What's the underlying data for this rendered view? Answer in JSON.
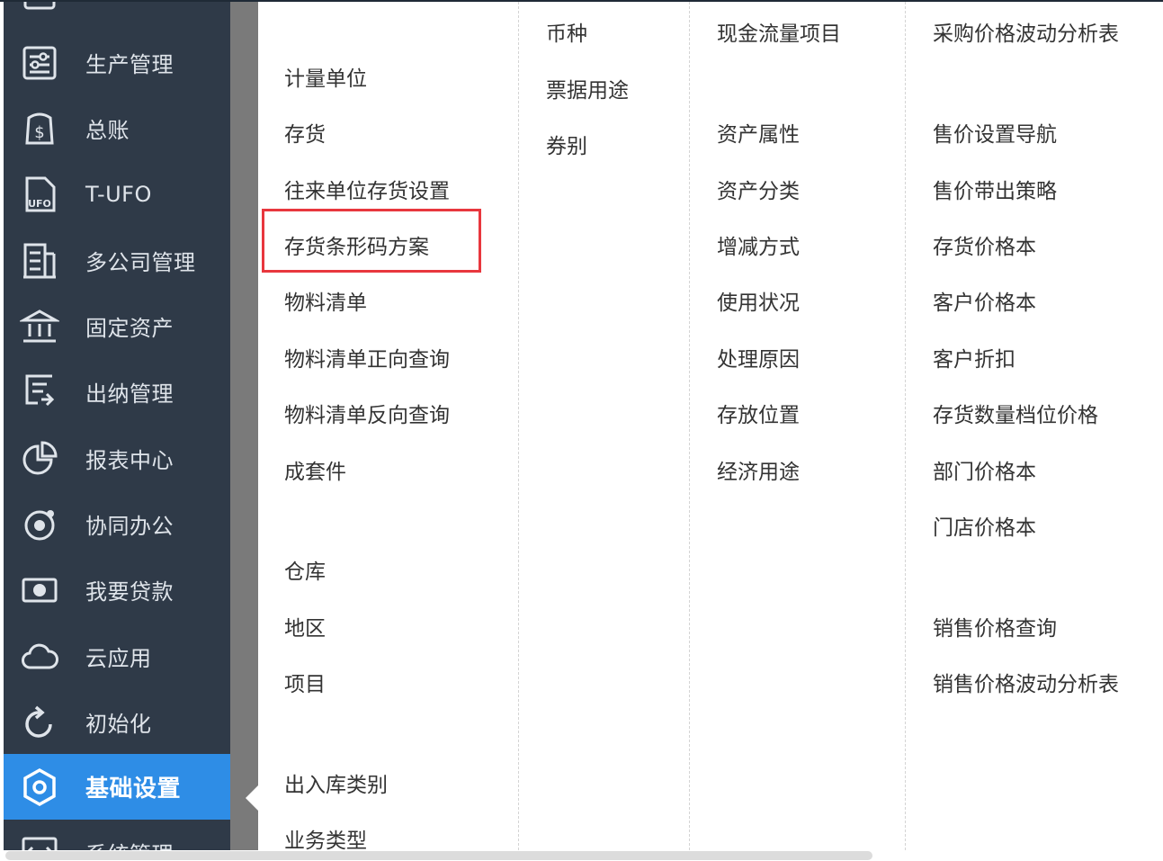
{
  "sidebar": {
    "items": [
      {
        "label": "生产管理",
        "icon": "production-icon"
      },
      {
        "label": "总账",
        "icon": "ledger-icon"
      },
      {
        "label": "T-UFO",
        "icon": "ufo-document-icon"
      },
      {
        "label": "多公司管理",
        "icon": "multi-company-icon"
      },
      {
        "label": "固定资产",
        "icon": "bank-building-icon"
      },
      {
        "label": "出纳管理",
        "icon": "cashier-icon"
      },
      {
        "label": "报表中心",
        "icon": "pie-chart-icon"
      },
      {
        "label": "协同办公",
        "icon": "collaboration-icon"
      },
      {
        "label": "我要贷款",
        "icon": "money-icon"
      },
      {
        "label": "云应用",
        "icon": "cloud-icon"
      },
      {
        "label": "初始化",
        "icon": "refresh-icon"
      },
      {
        "label": "基础设置",
        "icon": "gear-icon",
        "active": true
      },
      {
        "label": "系统管理",
        "icon": "system-icon"
      }
    ]
  },
  "menu": {
    "col1": [
      "计量单位",
      "存货",
      "往来单位存货设置",
      "存货条形码方案",
      "物料清单",
      "物料清单正向查询",
      "物料清单反向查询",
      "成套件",
      "仓库",
      "地区",
      "项目",
      "出入库类别",
      "业务类型"
    ],
    "col2": [
      "币种",
      "票据用途",
      "券别"
    ],
    "col3": [
      "现金流量项目",
      "资产属性",
      "资产分类",
      "增减方式",
      "使用状况",
      "处理原因",
      "存放位置",
      "经济用途"
    ],
    "col4": [
      "采购价格波动分析表",
      "售价设置导航",
      "售价带出策略",
      "存货价格本",
      "客户价格本",
      "客户折扣",
      "存货数量档位价格",
      "部门价格本",
      "门店价格本",
      "销售价格查询",
      "销售价格波动分析表"
    ],
    "highlighted_item": "存货条形码方案"
  },
  "colors": {
    "sidebar_bg": "#2f3a48",
    "active_bg": "#2e8de6",
    "highlight_border": "#e8373e"
  }
}
